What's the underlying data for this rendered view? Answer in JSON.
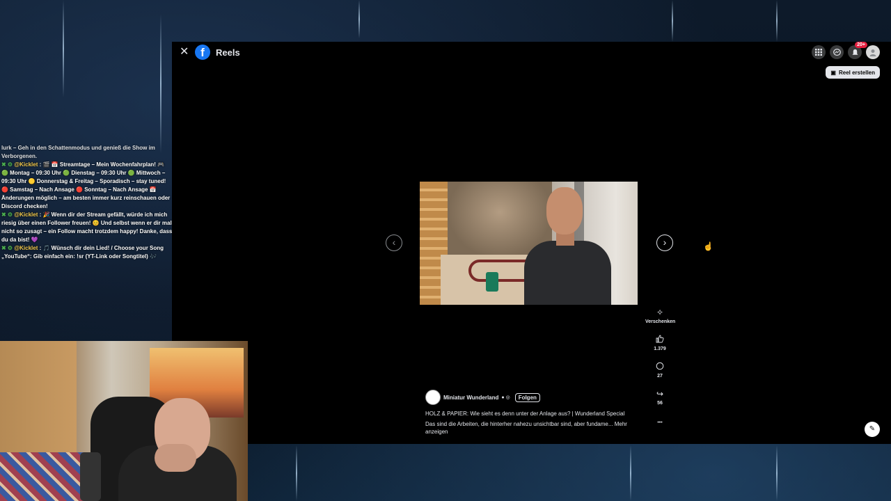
{
  "header": {
    "close_label": "✕",
    "app_title": "Reels",
    "create_reel": "Reel erstellen",
    "notif_badge": "20+"
  },
  "video": {
    "actions": [
      {
        "icon": "gift-icon",
        "glyph": "✧",
        "label": "Verschenken"
      },
      {
        "icon": "like-icon",
        "glyph": "👍",
        "label": "1.379"
      },
      {
        "icon": "comment-icon",
        "glyph": "◯",
        "label": "27"
      },
      {
        "icon": "share-icon",
        "glyph": "↪",
        "label": "56"
      },
      {
        "icon": "more-icon",
        "glyph": "•••",
        "label": ""
      }
    ],
    "author": "Miniatur Wunderland",
    "follow_label": "Folgen",
    "title": "HOLZ & PAPIER: Wie sieht es denn unter der Anlage aus? | Wunderland Special",
    "description": "Das sind die Arbeiten, die hinterher nahezu unsichtbar sind, aber fundame... Mehr anzeigen"
  },
  "chat": {
    "partial": "lurk – Geh in den Schattenmodus und genieß die Show im Verborgenen.",
    "messages": [
      {
        "user": "@Kicklet",
        "text": "🎬 📅 Streamtage – Mein Wochenfahrplan! 🎮 🟢 Montag – 09:30 Uhr 🟢 Dienstag – 09:30 Uhr 🟢 Mittwoch – 09:30 Uhr 🟡 Donnerstag & Freitag – Sporadisch – stay tuned! 🔴 Samstag – Nach Ansage 🔴 Sonntag – Nach Ansage 📅 Änderungen möglich – am besten immer kurz reinschauen oder Discord checken!"
      },
      {
        "user": "@Kicklet",
        "text": "🎉 Wenn dir der Stream gefällt, würde ich mich riesig über einen Follower freuen! 😊 Und selbst wenn er dir mal nicht so zusagt – ein Follow macht trotzdem happy! Danke, dass du da bist! 💜"
      },
      {
        "user": "@Kicklet",
        "text": "🎵 Wünsch dir dein Lied! / Choose your Song „YouTube“: Gib einfach ein: !sr (YT-Link oder Songtitel) 🎶"
      }
    ]
  }
}
